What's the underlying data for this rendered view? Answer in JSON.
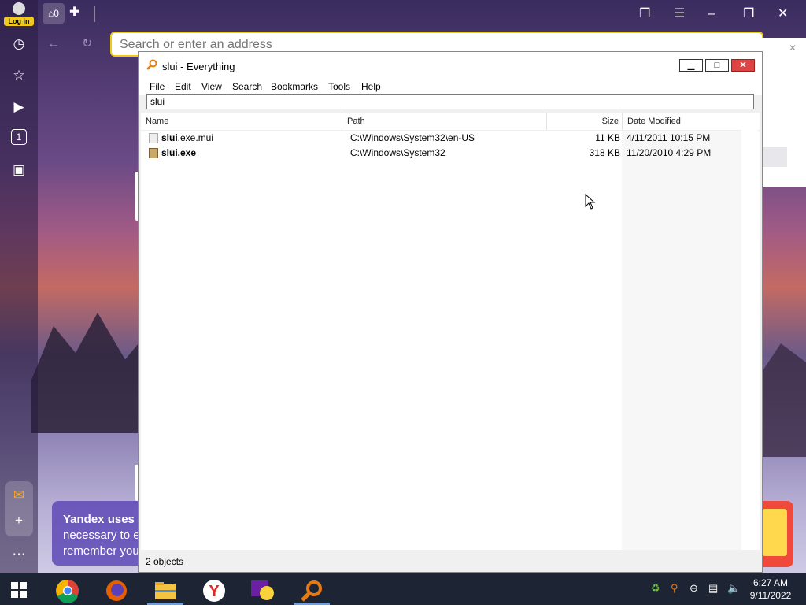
{
  "browser": {
    "login_label": "Log in",
    "home_tab_count": "0",
    "address_placeholder": "Search or enter an address",
    "sidebar_counter": "1",
    "cookie_line1": "Yandex uses",
    "cookie_line2": "necessary to e",
    "cookie_line3": "remember you"
  },
  "window": {
    "title": "slui - Everything",
    "menus": [
      "File",
      "Edit",
      "View",
      "Search",
      "Bookmarks",
      "Tools",
      "Help"
    ],
    "search_value": "slui",
    "columns": {
      "name": "Name",
      "path": "Path",
      "size": "Size",
      "date": "Date Modified"
    },
    "rows": [
      {
        "name_bold": "slui",
        "name_rest": ".exe.mui",
        "path": "C:\\Windows\\System32\\en-US",
        "size": "11 KB",
        "date": "4/11/2011 10:15 PM",
        "icon": "document-icon"
      },
      {
        "name_bold": "slui",
        "name_rest": ".exe",
        "path": "C:\\Windows\\System32",
        "size": "318 KB",
        "date": "11/20/2010 4:29 PM",
        "icon": "key-app-icon"
      }
    ],
    "status": "2 objects"
  },
  "taskbar": {
    "time": "6:27 AM",
    "date": "9/11/2022",
    "apps": [
      "chrome-icon",
      "firefox-icon",
      "file-explorer-icon",
      "yandex-icon",
      "yahoo-messenger-icon",
      "everything-search-icon"
    ]
  }
}
